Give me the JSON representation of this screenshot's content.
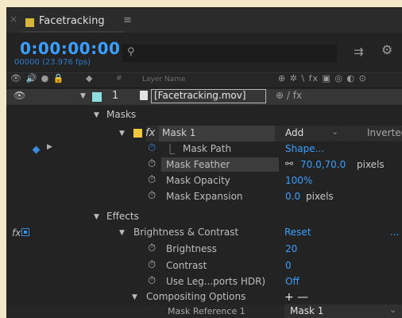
{
  "tab": {
    "close": "×",
    "title": "Facetracking",
    "menu": "≡"
  },
  "time": {
    "timecode": "0:00:00:00",
    "frames": "00000 (23.976 fps)"
  },
  "search": {
    "icon": "⚲",
    "placeholder": ""
  },
  "toolbar": {
    "icon1": "⇉",
    "icon2": "⚙"
  },
  "header": {
    "av_icons": "👁 🔊 ● 🔒",
    "label_icon": "◆",
    "hash": "#",
    "layer_name": "Layer Name",
    "switches": "⊕ ✲ \\ fx ▣ ◎ ◐ ⊙"
  },
  "layer": {
    "eye": "👁",
    "twirl": "▼",
    "number": "1",
    "name": "[Facetracking.mov]",
    "switch_text": "⊕   / fx"
  },
  "masks": {
    "label": "Masks",
    "twirl": "▼",
    "mask": {
      "twirl": "▼",
      "fx": "fx",
      "name": "Mask 1",
      "mode": "Add",
      "mode_arrow": "⌄",
      "inverted": "Inverted"
    },
    "properties": [
      {
        "label": "Mask Path",
        "value": "Shape...",
        "unit": ""
      },
      {
        "label": "Mask Feather",
        "value": "70.0,70.0",
        "unit": "pixels",
        "link": "⚯"
      },
      {
        "label": "Mask Opacity",
        "value": "100%",
        "unit": ""
      },
      {
        "label": "Mask Expansion",
        "value": "0.0",
        "unit": "pixels"
      }
    ]
  },
  "effects": {
    "label": "Effects",
    "twirl": "▼",
    "fx_left": "fx",
    "effect": {
      "twirl": "▼",
      "name": "Brightness & Contrast",
      "reset": "Reset",
      "more": "..."
    },
    "params": [
      {
        "label": "Brightness",
        "value": "20"
      },
      {
        "label": "Contrast",
        "value": "0"
      },
      {
        "label": "Use Leg...ports HDR)",
        "value": "Off"
      }
    ],
    "compositing": {
      "twirl": "▼",
      "label": "Compositing Options",
      "plus_minus": "+ —",
      "mask_ref_label": "Mask Reference 1",
      "mask_ref_value": "Mask 1"
    }
  },
  "icons": {
    "stopwatch": "stopwatch-icon",
    "graph": "graph-icon"
  },
  "colors": {
    "accent_blue": "#3aa0ff",
    "comp_chip": "#d6b73a",
    "layer_label": "#8ee0e0",
    "mask_color": "#eec83a",
    "panel_bg": "#232323"
  }
}
